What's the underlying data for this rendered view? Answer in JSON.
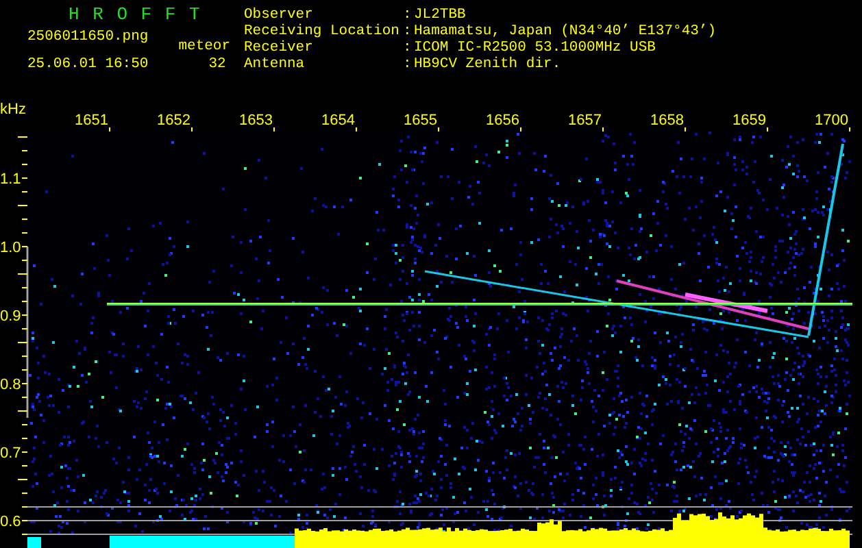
{
  "header": {
    "title": "H R O F F T",
    "filename": "2506011650.png",
    "timestamp": "25.06.01 16:50",
    "counter_label": "meteor",
    "counter_value": "32"
  },
  "station_info": [
    {
      "label": "Observer",
      "separator": ":",
      "value": "JL2TBB"
    },
    {
      "label": "Receiving Location",
      "separator": ":",
      "value": "Hamamatsu, Japan (N34°40’ E137°43’)"
    },
    {
      "label": "Receiver",
      "separator": ":",
      "value": "ICOM IC-R2500 53.1000MHz USB"
    },
    {
      "label": "Antenna",
      "separator": ":",
      "value": "HB9CV Zenith dir."
    }
  ],
  "plot": {
    "y_unit": "kHz",
    "x_labels": [
      "1651",
      "1652",
      "1653",
      "1654",
      "1655",
      "1656",
      "1657",
      "1658",
      "1659",
      "1700"
    ],
    "y_labels": [
      "1.1",
      "1.0",
      "0.9",
      "0.8",
      "0.7",
      "0.6"
    ]
  }
}
